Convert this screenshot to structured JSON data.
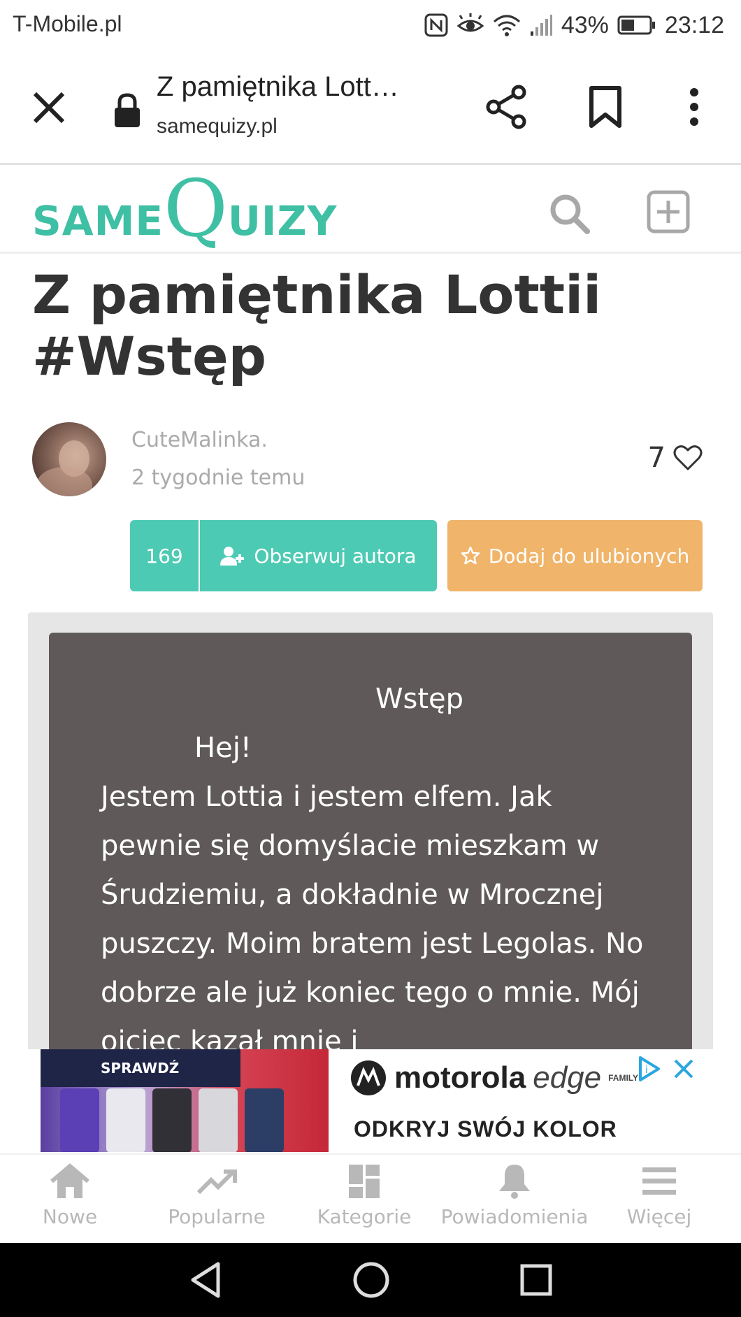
{
  "status_bar": {
    "carrier": "T-Mobile.pl",
    "battery": "43%",
    "time": "23:12"
  },
  "browser": {
    "page_title": "Z pamiętnika Lott…",
    "domain": "samequizy.pl"
  },
  "site": {
    "logo_same": "SAME",
    "logo_q": "Q",
    "logo_uizy": "UIZY",
    "brand_color": "#3fbfa4"
  },
  "quiz": {
    "title": "Z pamiętnika Lottii #Wstęp",
    "author": "CuteMalinka.",
    "time_ago": "2 tygodnie temu",
    "likes": "7",
    "followers": "169",
    "follow_label": "Obserwuj autora",
    "favorite_label": "Dodaj do ulubionych",
    "content_heading": "Wstęp",
    "content_greeting": "Hej!",
    "content_body": "  Jestem Lottia i jestem elfem. Jak pewnie się domyślacie mieszkam w Śrudziemiu, a dokładnie w Mrocznej puszczy. Moim bratem jest Legolas. No dobrze ale już koniec tego o mnie. Mój ojciec kazał mnie i"
  },
  "ad": {
    "badge": "SPRAWDŹ",
    "brand": "motorola",
    "product": "edge",
    "family": "FAMILY",
    "tagline": "ODKRYJ SWÓJ KOLOR"
  },
  "bottom_nav": {
    "items": [
      {
        "label": "Nowe",
        "icon": "home-icon"
      },
      {
        "label": "Popularne",
        "icon": "trending-icon"
      },
      {
        "label": "Kategorie",
        "icon": "categories-icon"
      },
      {
        "label": "Powiadomienia",
        "icon": "bell-icon"
      },
      {
        "label": "Więcej",
        "icon": "menu-icon"
      }
    ]
  },
  "colors": {
    "follow_button": "#4dcab3",
    "favorite_button": "#f0b46a",
    "content_box": "#5f5a59",
    "nav_gray": "#b8b8b8"
  }
}
